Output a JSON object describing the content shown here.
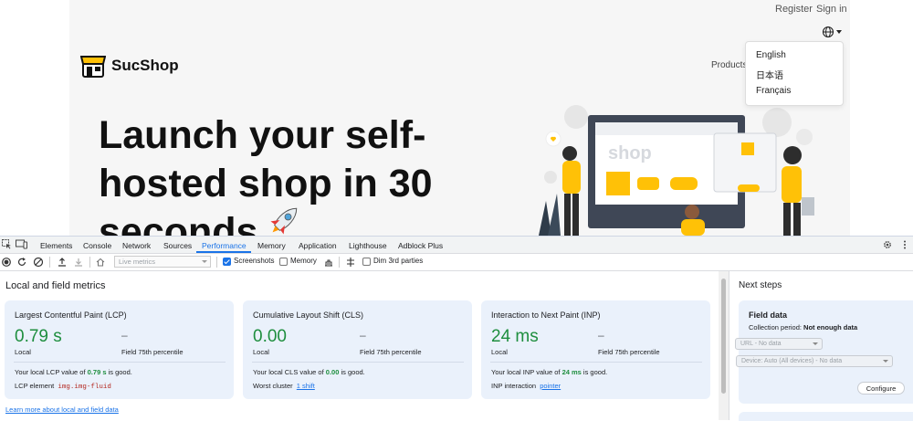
{
  "site": {
    "brand": "SucShop",
    "header_links": {
      "register": "Register",
      "sign_in": "Sign in"
    },
    "nav_products": "Products",
    "languages": [
      "English",
      "日本语",
      "Français"
    ],
    "hero_lines": [
      "Launch your self-",
      "hosted shop in 30",
      "seconds"
    ],
    "hero_emoji": "🚀",
    "illustration_text": "shop",
    "colors": {
      "accent": "#ffc107",
      "page_bg": "#f6f6f6"
    }
  },
  "devtools": {
    "tabs": [
      "Elements",
      "Console",
      "Network",
      "Sources",
      "Performance",
      "Memory",
      "Application",
      "Lighthouse",
      "Adblock Plus"
    ],
    "active_tab": "Performance",
    "toolbar": {
      "live_metrics_placeholder": "Live metrics",
      "screenshots": "Screenshots",
      "screenshots_checked": true,
      "memory": "Memory",
      "memory_checked": false,
      "dim_3rd_parties": "Dim 3rd parties",
      "dim_checked": false
    },
    "main": {
      "heading": "Local and field metrics",
      "learn_more": "Learn more about local and field data",
      "cards": [
        {
          "title": "Largest Contentful Paint (LCP)",
          "value": "0.79 s",
          "field_value": "–",
          "local_label": "Local",
          "field_label": "Field 75th percentile",
          "msg_prefix": "Your local LCP value of ",
          "msg_value": "0.79 s",
          "msg_suffix": " is good.",
          "detail_label": "LCP element",
          "detail_value": "img.img-fluid"
        },
        {
          "title": "Cumulative Layout Shift (CLS)",
          "value": "0.00",
          "field_value": "–",
          "local_label": "Local",
          "field_label": "Field 75th percentile",
          "msg_prefix": "Your local CLS value of ",
          "msg_value": "0.00",
          "msg_suffix": " is good.",
          "detail_label": "Worst cluster",
          "detail_value": "1 shift"
        },
        {
          "title": "Interaction to Next Paint (INP)",
          "value": "24 ms",
          "field_value": "–",
          "local_label": "Local",
          "field_label": "Field 75th percentile",
          "msg_prefix": "Your local INP value of ",
          "msg_value": "24 ms",
          "msg_suffix": " is good.",
          "detail_label": "INP interaction",
          "detail_value": "pointer"
        }
      ]
    },
    "side": {
      "heading": "Next steps",
      "field_heading": "Field data",
      "collection_label": "Collection period: ",
      "collection_value": "Not enough data",
      "url_select": "URL - No data",
      "device_select": "Device: Auto (All devices) - No data",
      "configure": "Configure"
    },
    "colors": {
      "active": "#1a73e8",
      "good": "#1e8e3e",
      "card_bg": "#eaf1fb"
    }
  }
}
